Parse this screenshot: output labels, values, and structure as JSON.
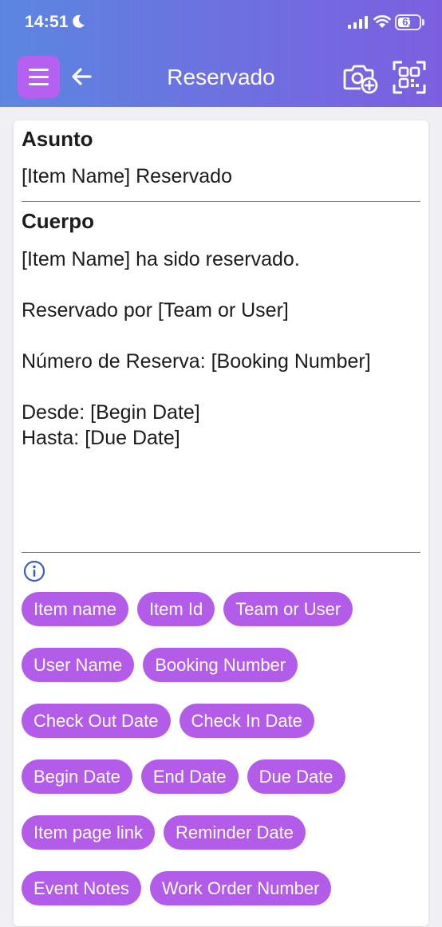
{
  "status_bar": {
    "time": "14:51",
    "battery": "61"
  },
  "header": {
    "title": "Reservado"
  },
  "subject": {
    "label": "Asunto",
    "value": "[Item Name] Reservado"
  },
  "body": {
    "label": "Cuerpo",
    "text": "[Item Name] ha sido reservado.\n\nReservado por [Team or User]\n\nNúmero de Reserva: [Booking Number]\n\nDesde: [Begin Date]\nHasta: [Due Date]"
  },
  "tags": [
    [
      "Item name",
      "Item Id",
      "Team or User"
    ],
    [
      "User Name",
      "Booking Number"
    ],
    [
      "Check Out Date",
      "Check In Date"
    ],
    [
      "Begin Date",
      "End Date",
      "Due Date"
    ],
    [
      "Item page link",
      "Reminder Date"
    ],
    [
      "Event Notes",
      "Work Order Number"
    ]
  ],
  "colors": {
    "accent": "#b35ce9",
    "header_start": "#5b86e0",
    "header_end": "#7c5fe0"
  }
}
